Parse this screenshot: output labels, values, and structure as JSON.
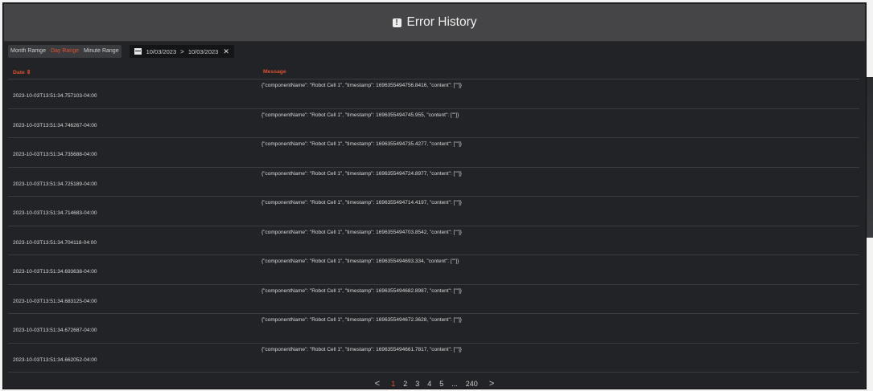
{
  "header": {
    "title": "Error History"
  },
  "toolbar": {
    "ranges": [
      "Month Ramge",
      "Day Range",
      "Minute Range"
    ],
    "active_range": "Day Range",
    "date_start": "10/03/2023",
    "date_end": "10/03/2023",
    "arrow": ">",
    "clear": "✕"
  },
  "table": {
    "columns": {
      "date": "Date ⇕",
      "message": "Message"
    },
    "rows": [
      {
        "date": "2023-10-03T13:51:34.757103-04:00",
        "message": "{\"componentName\": \"Robot Cell 1\", \"timestamp\": 1696355494756.8416, \"content\": [\"\"]}"
      },
      {
        "date": "2023-10-03T13:51:34.746267-04:00",
        "message": "{\"componentName\": \"Robot Cell 1\", \"timestamp\": 1696355494745.955, \"content\": [\"\"]}"
      },
      {
        "date": "2023-10-03T13:51:34.735688-04:00",
        "message": "{\"componentName\": \"Robot Cell 1\", \"timestamp\": 1696355494735.4277, \"content\": [\"\"]}"
      },
      {
        "date": "2023-10-03T13:51:34.725189-04:00",
        "message": "{\"componentName\": \"Robot Cell 1\", \"timestamp\": 1696355494724.8977, \"content\": [\"\"]}"
      },
      {
        "date": "2023-10-03T13:51:34.714683-04:00",
        "message": "{\"componentName\": \"Robot Cell 1\", \"timestamp\": 1696355494714.4197, \"content\": [\"\"]}"
      },
      {
        "date": "2023-10-03T13:51:34.704118-04:00",
        "message": "{\"componentName\": \"Robot Cell 1\", \"timestamp\": 1696355494703.8542, \"content\": [\"\"]}"
      },
      {
        "date": "2023-10-03T13:51:34.693638-04:00",
        "message": "{\"componentName\": \"Robot Cell 1\", \"timestamp\": 1696355494693.334, \"content\": [\"\"]}"
      },
      {
        "date": "2023-10-03T13:51:34.683125-04:00",
        "message": "{\"componentName\": \"Robot Cell 1\", \"timestamp\": 1696355494682.8987, \"content\": [\"\"]}"
      },
      {
        "date": "2023-10-03T13:51:34.672687-04:00",
        "message": "{\"componentName\": \"Robot Cell 1\", \"timestamp\": 1696355494672.3628, \"content\": [\"\"]}"
      },
      {
        "date": "2023-10-03T13:51:34.662052-04:00",
        "message": "{\"componentName\": \"Robot Cell 1\", \"timestamp\": 1696355494661.7817, \"content\": [\"\"]}"
      }
    ]
  },
  "pagination": {
    "prev": "<",
    "next": ">",
    "pages": [
      "1",
      "2",
      "3",
      "4",
      "5",
      "...",
      "240"
    ],
    "current": "1"
  },
  "colors": {
    "accent": "#e2502c",
    "background": "#222327",
    "header": "#454547"
  }
}
